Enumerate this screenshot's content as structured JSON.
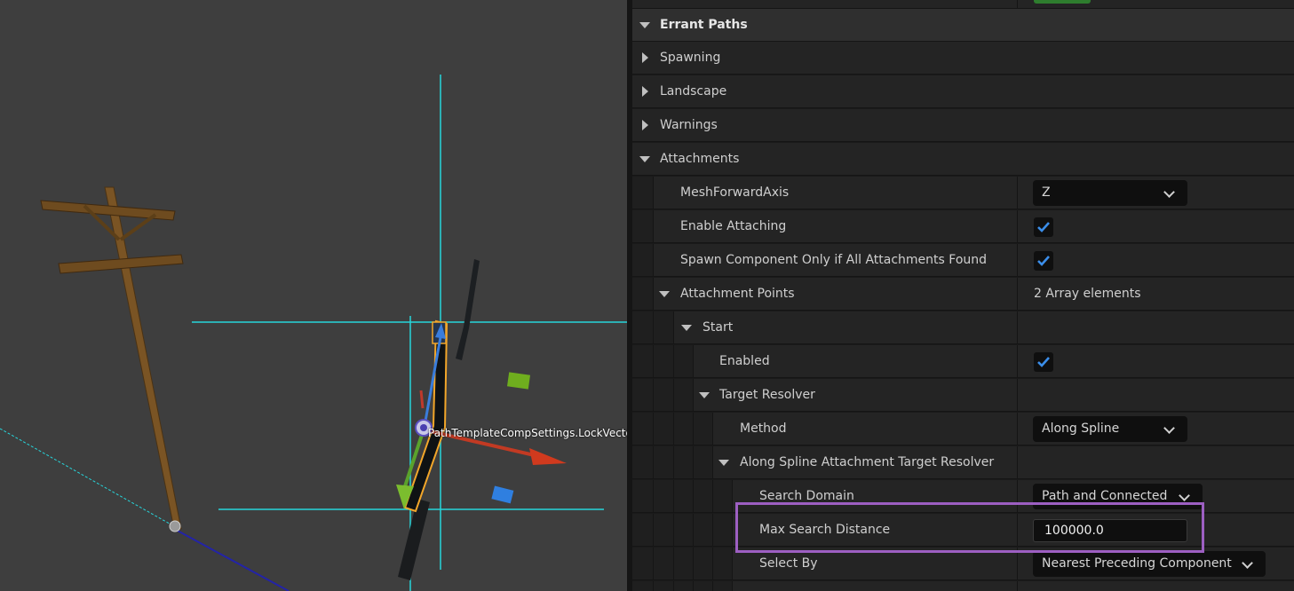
{
  "viewport": {
    "component_label": "PathTemplateCompSettings.LockVecto"
  },
  "details": {
    "category_title": "Errant Paths",
    "sections": {
      "spawning": "Spawning",
      "landscape": "Landscape",
      "warnings": "Warnings",
      "attachments": "Attachments"
    },
    "properties": {
      "mesh_forward_axis": {
        "label": "MeshForwardAxis",
        "value": "Z"
      },
      "enable_attaching": {
        "label": "Enable Attaching",
        "checked": true
      },
      "spawn_only_if_found": {
        "label": "Spawn Component Only if All Attachments Found",
        "checked": true
      },
      "attachment_points": {
        "label": "Attachment Points",
        "value": "2 Array elements"
      },
      "start": {
        "label": "Start"
      },
      "enabled": {
        "label": "Enabled",
        "checked": true
      },
      "target_resolver": {
        "label": "Target Resolver"
      },
      "method": {
        "label": "Method",
        "value": "Along Spline"
      },
      "along_spline_resolver": {
        "label": "Along Spline Attachment Target Resolver"
      },
      "search_domain": {
        "label": "Search Domain",
        "value": "Path and Connected"
      },
      "max_search_distance": {
        "label": "Max Search Distance",
        "value": "100000.0"
      },
      "select_by": {
        "label": "Select By",
        "value": "Nearest Preceding Component"
      }
    }
  },
  "colors": {
    "highlight": "#9d5fc2",
    "checkbox_tick": "#3b8eea",
    "viewport_bg": "#3e3e3e",
    "guide_lines": "#27d6dc"
  }
}
